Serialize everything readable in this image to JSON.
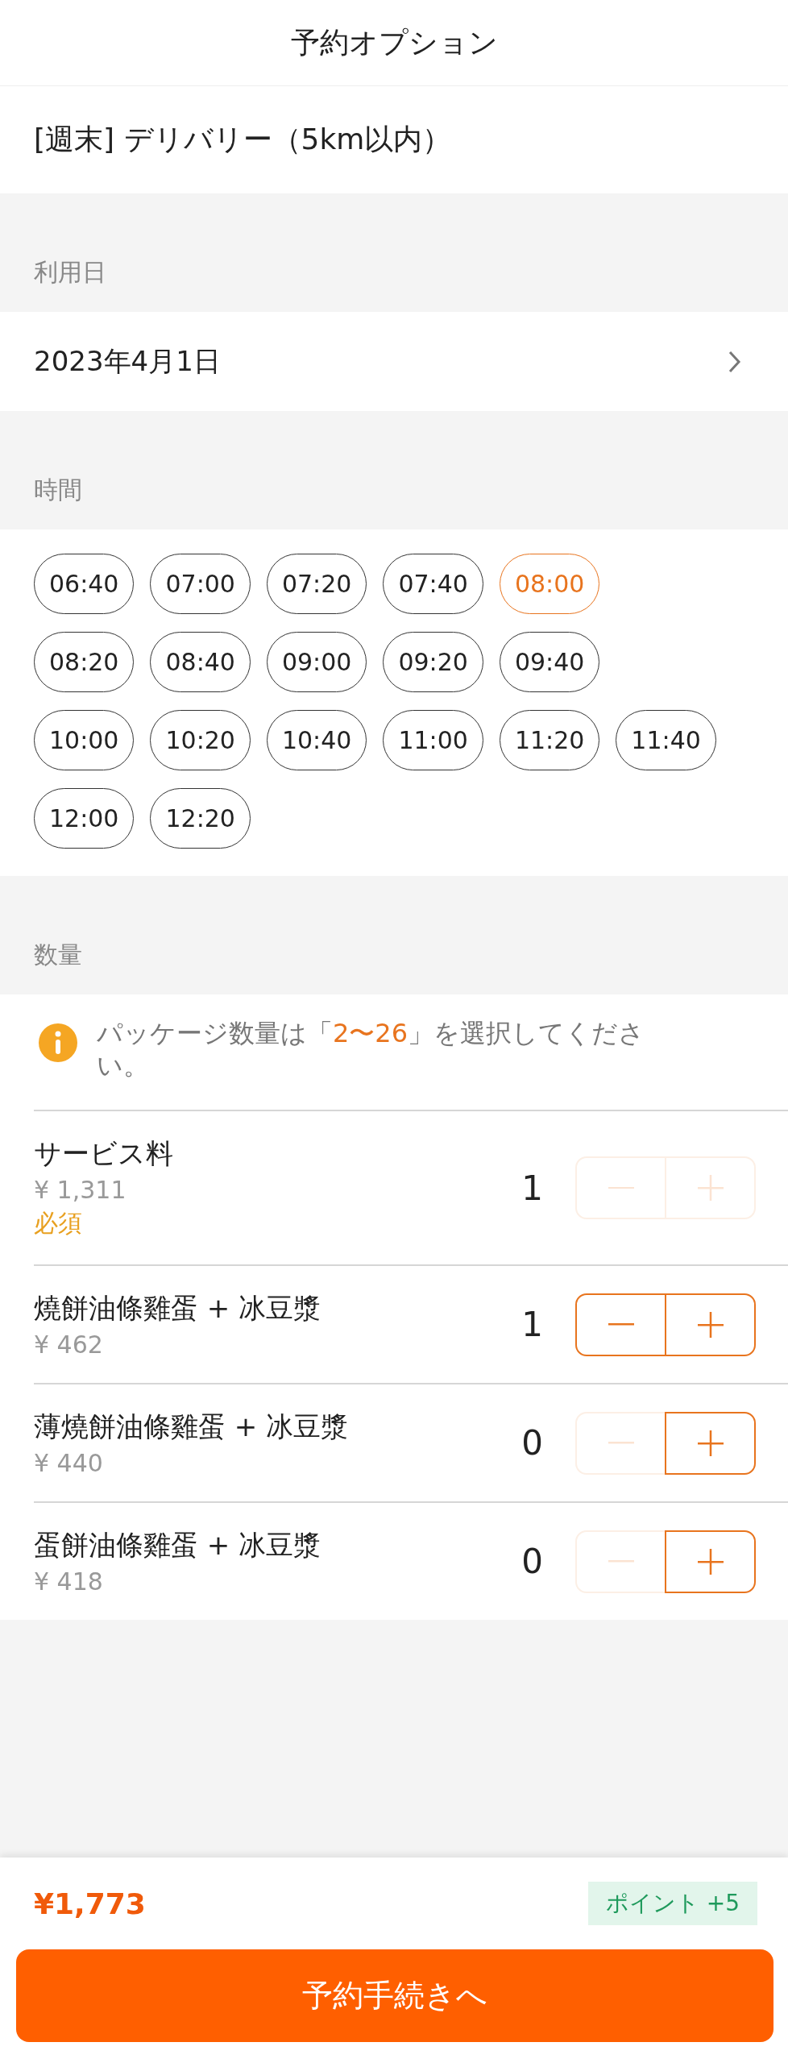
{
  "header": {
    "title": "予約オプション"
  },
  "option": {
    "label": "[週末] デリバリー（5km以内）"
  },
  "date_section": {
    "label": "利用日",
    "value": "2023年4月1日"
  },
  "time_section": {
    "label": "時間",
    "rows": [
      {
        "slots": [
          {
            "time": "06:40",
            "selected": false
          },
          {
            "time": "07:00",
            "selected": false
          },
          {
            "time": "07:20",
            "selected": false
          },
          {
            "time": "07:40",
            "selected": false
          },
          {
            "time": "08:00",
            "selected": true
          }
        ]
      },
      {
        "slots": [
          {
            "time": "08:20",
            "selected": false
          },
          {
            "time": "08:40",
            "selected": false
          },
          {
            "time": "09:00",
            "selected": false
          },
          {
            "time": "09:20",
            "selected": false
          },
          {
            "time": "09:40",
            "selected": false
          }
        ]
      },
      {
        "slots": [
          {
            "time": "10:00",
            "selected": false
          },
          {
            "time": "10:20",
            "selected": false
          },
          {
            "time": "10:40",
            "selected": false
          },
          {
            "time": "11:00",
            "selected": false
          },
          {
            "time": "11:20",
            "selected": false
          },
          {
            "time": "11:40",
            "selected": false
          }
        ]
      },
      {
        "slots": [
          {
            "time": "12:00",
            "selected": false
          },
          {
            "time": "12:20",
            "selected": false
          }
        ]
      }
    ]
  },
  "quantity_section": {
    "label": "数量",
    "notice": {
      "before": "パッケージ数量は「",
      "highlight": "2〜26",
      "after": "」を選択してください。"
    },
    "items": [
      {
        "name": "サービス料",
        "price": "¥ 1,311",
        "tag": "必須",
        "quantity": "1",
        "minus_disabled": true,
        "plus_disabled": true
      },
      {
        "name": "燒餅油條雞蛋 + 冰豆漿",
        "price": "¥ 462",
        "quantity": "1",
        "minus_disabled": false,
        "plus_disabled": false
      },
      {
        "name": "薄燒餅油條雞蛋 + 冰豆漿",
        "price": "¥ 440",
        "quantity": "0",
        "minus_disabled": true,
        "plus_disabled": false
      },
      {
        "name": "蛋餅油條雞蛋 + 冰豆漿",
        "price": "¥ 418",
        "quantity": "0",
        "minus_disabled": true,
        "plus_disabled": false
      }
    ]
  },
  "footer": {
    "total": "¥1,773",
    "points": "ポイント +5",
    "button": "予約手続きへ"
  }
}
